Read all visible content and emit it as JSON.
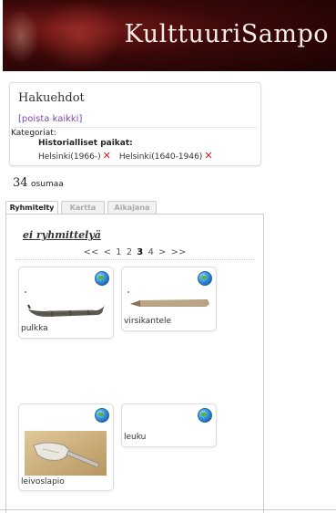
{
  "header": {
    "title": "KulttuuriSampo"
  },
  "search": {
    "heading": "Hakuehdot",
    "clear_all": "[poista kaikki]",
    "categories_label": "Kategoriat:",
    "historical_places_label": "Historialliset paikat:",
    "chips": [
      {
        "label": "Helsinki(1966-)"
      },
      {
        "label": "Helsinki(1640-1946)"
      }
    ]
  },
  "results": {
    "count": "34",
    "count_label": "osumaa"
  },
  "tabs": [
    {
      "label": "Ryhmitelty",
      "active": true
    },
    {
      "label": "Kartta",
      "active": false
    },
    {
      "label": "Aikajana",
      "active": false
    }
  ],
  "grouping": {
    "label": "ei ryhmittelyä"
  },
  "pager": {
    "first": "<<",
    "prev": "<",
    "pages": [
      "1",
      "2",
      "3",
      "4"
    ],
    "current": "3",
    "next": ">",
    "last": ">>"
  },
  "items": [
    {
      "label": "pulkka",
      "icon": "sled-thumbnail"
    },
    {
      "label": "virsikantele",
      "icon": "kantele-thumbnail"
    },
    {
      "label": "leivoslapio",
      "icon": "pastry-server-thumbnail"
    },
    {
      "label": "leuku",
      "icon": "none"
    }
  ],
  "colors": {
    "banner": "#3a0808",
    "remove": "#d62020",
    "link": "#7a47a8"
  }
}
